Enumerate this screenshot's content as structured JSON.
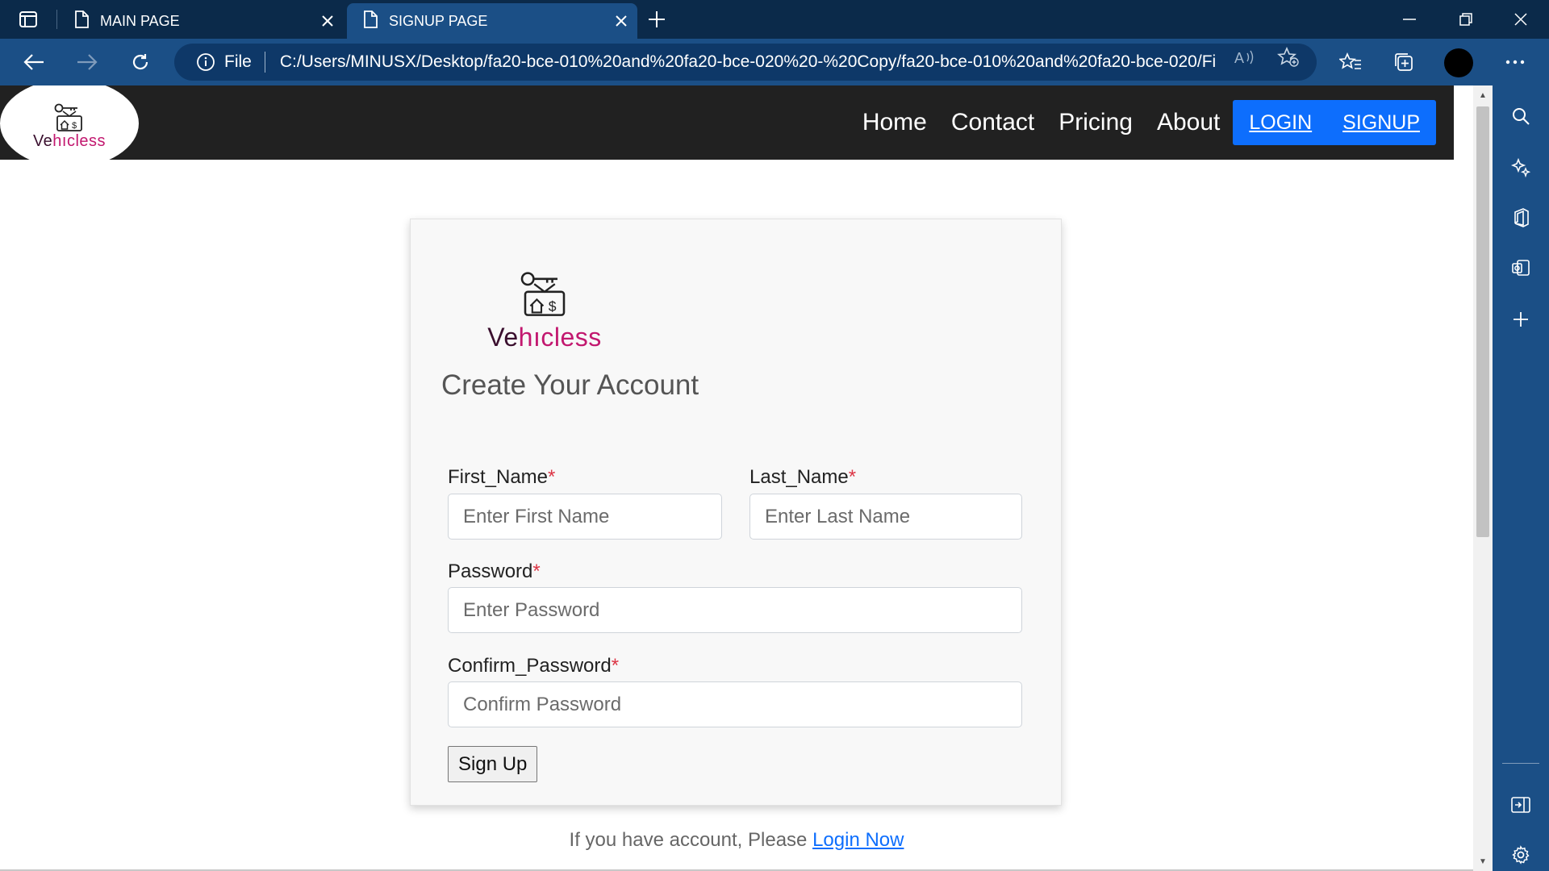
{
  "browser": {
    "tabs": [
      {
        "label": "MAIN PAGE",
        "active": false
      },
      {
        "label": "SIGNUP PAGE",
        "active": true
      }
    ],
    "address": {
      "scheme_label": "File",
      "url": "C:/Users/MINUSX/Desktop/fa20-bce-010%20and%20fa20-bce-020%20-%20Copy/fa20-bce-010%20and%20fa20-bce-020/Fi..."
    }
  },
  "site": {
    "brand": {
      "prefix": "Ve",
      "accent_h": "h",
      "accent_i": "ı",
      "suffix": "cless"
    },
    "nav": {
      "home": "Home",
      "contact": "Contact",
      "pricing": "Pricing",
      "about": "About",
      "login": "LOGIN",
      "signup": "SIGNUP"
    }
  },
  "form": {
    "title": "Create Your Account",
    "first_name": {
      "label": "First_Name",
      "placeholder": "Enter First Name"
    },
    "last_name": {
      "label": "Last_Name",
      "placeholder": "Enter Last Name"
    },
    "password": {
      "label": "Password",
      "placeholder": "Enter Password"
    },
    "confirm_password": {
      "label": "Confirm_Password",
      "placeholder": "Confirm Password"
    },
    "required_mark": "*",
    "submit_label": "Sign Up"
  },
  "footer": {
    "hint_text": "If you have account, Please ",
    "login_link": "Login Now"
  },
  "colors": {
    "tabstrip": "#0b2a4a",
    "toolbar": "#1b4f86",
    "nav_bg": "#212121",
    "auth_blue": "#0d6efd",
    "brand_dark": "#3a0f2e",
    "brand_accent": "#c2186f",
    "required": "#dc3545"
  }
}
